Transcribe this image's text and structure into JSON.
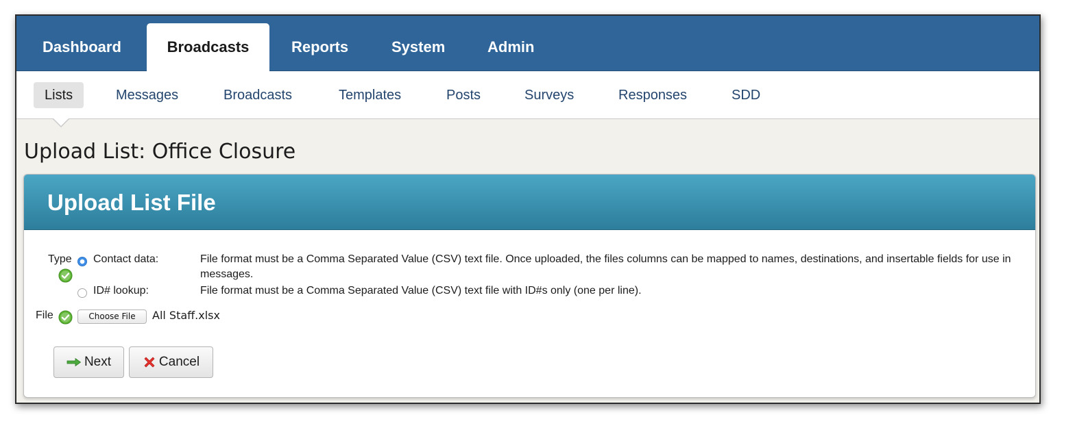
{
  "topnav": {
    "tabs": [
      {
        "label": "Dashboard"
      },
      {
        "label": "Broadcasts"
      },
      {
        "label": "Reports"
      },
      {
        "label": "System"
      },
      {
        "label": "Admin"
      }
    ],
    "active_tab": "Broadcasts"
  },
  "subnav": {
    "items": [
      {
        "label": "Lists"
      },
      {
        "label": "Messages"
      },
      {
        "label": "Broadcasts"
      },
      {
        "label": "Templates"
      },
      {
        "label": "Posts"
      },
      {
        "label": "Surveys"
      },
      {
        "label": "Responses"
      },
      {
        "label": "SDD"
      }
    ],
    "active_item": "Lists"
  },
  "page_title": "Upload List: Office Closure",
  "panel": {
    "title": "Upload List File",
    "type_label": "Type",
    "options": [
      {
        "label": "Contact data:",
        "selected": true,
        "description": "File format must be a Comma Separated Value (CSV) text file. Once uploaded, the files columns can be mapped to names, destinations, and insertable fields for use in messages."
      },
      {
        "label": "ID# lookup:",
        "selected": false,
        "description": "File format must be a Comma Separated Value (CSV) text file with ID#s only (one per line)."
      }
    ],
    "file_label": "File",
    "choose_file_label": "Choose File",
    "file_name": "All Staff.xlsx",
    "next_label": "Next",
    "cancel_label": "Cancel"
  },
  "icons": {
    "valid": "check-circle-icon",
    "next": "arrow-right-icon",
    "cancel": "x-mark-icon"
  },
  "colors": {
    "nav_bg": "#2f6598",
    "panel_header": "#3b94b3",
    "link": "#23456e",
    "radio_selected": "#3f8fe8",
    "check_green": "#5cb531",
    "cancel_red": "#e8322d",
    "next_green": "#4caa3e"
  }
}
